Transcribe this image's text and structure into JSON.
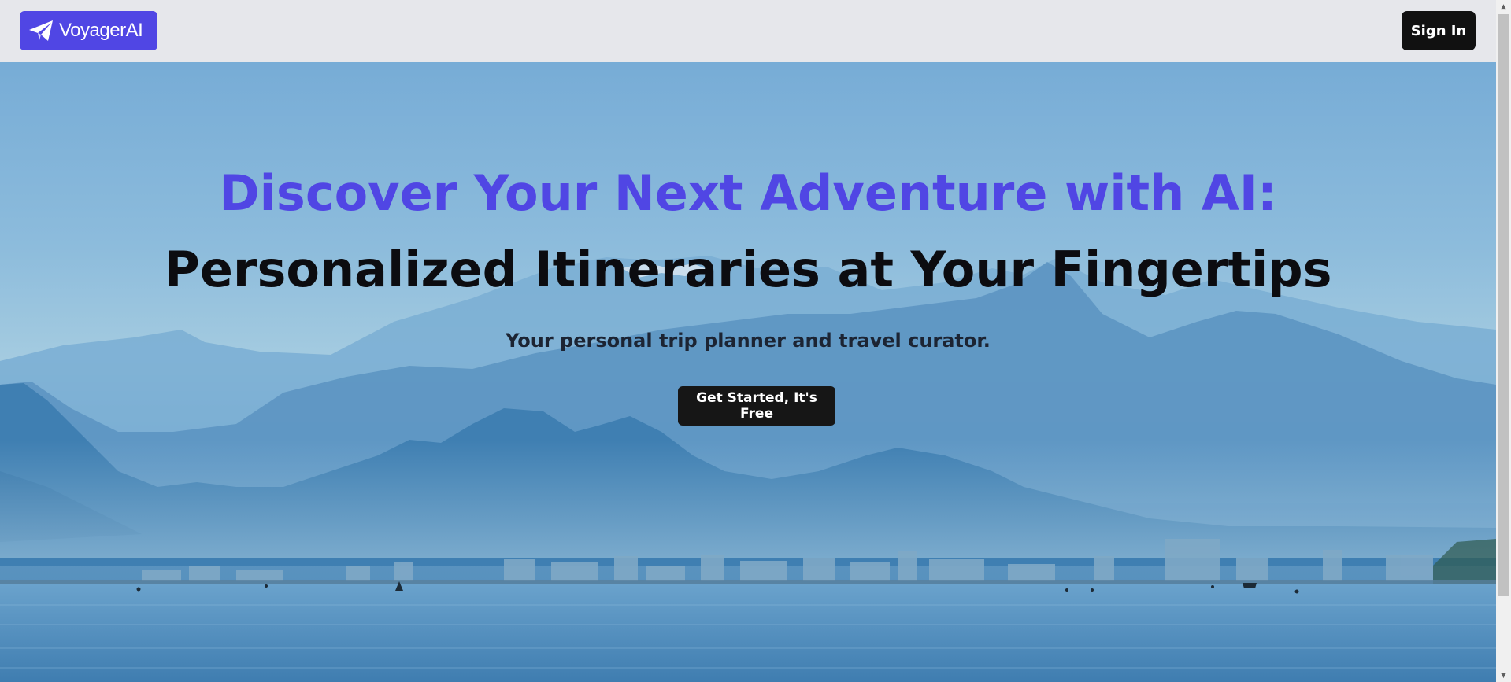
{
  "brand": {
    "name": "VoyagerAI",
    "icon": "paper-plane-icon",
    "color": "#5046e4"
  },
  "nav": {
    "sign_in_label": "Sign In"
  },
  "hero": {
    "headline_line1": "Discover Your Next Adventure with AI:",
    "headline_line2": "Personalized Itineraries at Your Fingertips",
    "subtitle": "Your personal trip planner and travel curator.",
    "cta_label": "Get Started, It's Free",
    "background": "mountains-lake-city-photo"
  },
  "scrollbar": {
    "up_icon": "triangle-up-icon",
    "down_icon": "triangle-down-icon"
  }
}
